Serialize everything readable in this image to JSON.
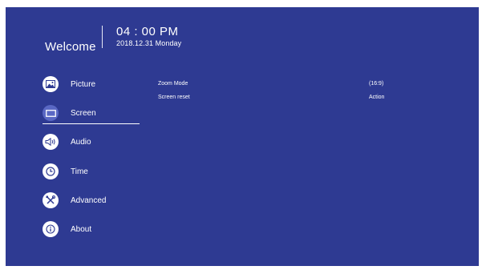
{
  "header": {
    "welcome": "Welcome",
    "time": "04 : 00 PM",
    "date": "2018.12.31 Monday"
  },
  "menu": {
    "items": [
      {
        "label": "Picture",
        "icon": "picture-icon"
      },
      {
        "label": "Screen",
        "icon": "screen-icon",
        "selected": true
      },
      {
        "label": "Audio",
        "icon": "speaker-icon"
      },
      {
        "label": "Time",
        "icon": "clock-icon"
      },
      {
        "label": "Advanced",
        "icon": "tools-icon"
      },
      {
        "label": "About",
        "icon": "info-icon"
      }
    ]
  },
  "screen_settings": {
    "rows": [
      {
        "name": "Zoom Mode",
        "value": "(16:9)"
      },
      {
        "name": "Screen reset",
        "value": "Action"
      }
    ]
  },
  "colors": {
    "background": "#2e3a92",
    "selected_circle": "#5a68c4",
    "text": "#ffffff"
  }
}
